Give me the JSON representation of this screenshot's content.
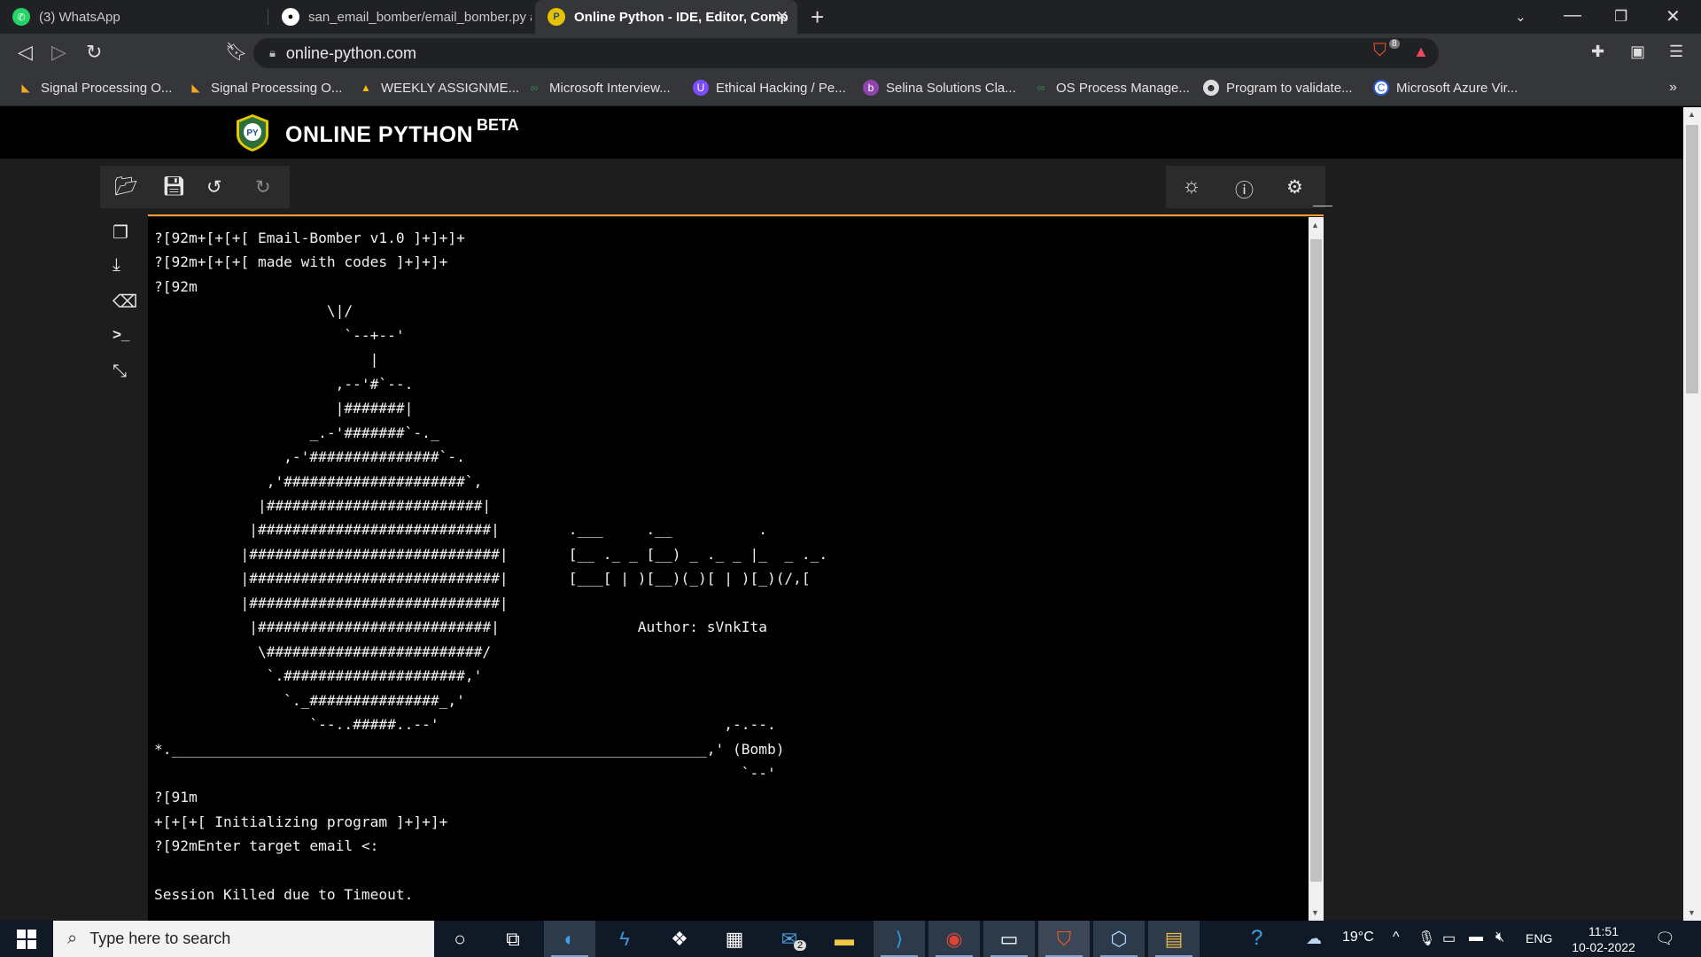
{
  "browser": {
    "tabs": [
      {
        "title": "(3) WhatsApp",
        "icon": "whatsapp-icon",
        "active": false
      },
      {
        "title": "san_email_bomber/email_bomber.py a",
        "icon": "github-icon",
        "active": false
      },
      {
        "title": "Online Python - IDE, Editor, Comp",
        "icon": "online-python-icon",
        "active": true
      }
    ],
    "url": "online-python.com",
    "brave_badge": "8",
    "bookmarks": [
      "Signal Processing O...",
      "Signal Processing O...",
      "WEEKLY ASSIGNME...",
      "Microsoft Interview...",
      "Ethical Hacking / Pe...",
      "Selina Solutions Cla...",
      "OS Process Manage...",
      "Program to validate...",
      "Microsoft Azure Vir..."
    ]
  },
  "site": {
    "logo_text": "PY",
    "title": "ONLINE PYTHON",
    "badge": "BETA"
  },
  "terminal": {
    "lines": [
      "?[92m+[+[+[ Email-Bomber v1.0 ]+]+]+",
      "?[92m+[+[+[ made with codes ]+]+]+",
      "?[92m",
      "                    \\|/",
      "                      `--+--'",
      "                         |",
      "                     ,--'#`--.",
      "                     |#######|",
      "                  _.-'#######`-._",
      "               ,-'###############`-.",
      "             ,'#####################`,",
      "            |#########################|",
      "           |###########################|        .___     .__          .",
      "          |#############################|       [__ ._ _ [__) _ ._ _ |_  _ ._.",
      "          |#############################|       [___[ | )[__)(_)[ | )[_)(/,[",
      "          |#############################|",
      "           |###########################|                Author: sVnkIta",
      "            \\#########################/",
      "             `.#####################,'",
      "               `._###############_,'",
      "                  `--..#####..--'                                 ,-.--.",
      "*.______________________________________________________________,' (Bomb)",
      "                                                                    `--'",
      "?[91m",
      "+[+[+[ Initializing program ]+]+]+",
      "?[92mEnter target email <:",
      "",
      "Session Killed due to Timeout."
    ]
  },
  "taskbar": {
    "search_placeholder": "Type here to search",
    "mail_badge": "2",
    "temperature": "19°C",
    "language": "ENG",
    "time": "11:51",
    "date": "10-02-2022"
  },
  "colors": {
    "accent_orange": "#ff9d33",
    "terminal_bg": "#000000",
    "terminal_fg": "#f0f0f0",
    "chrome_dark": "#202124",
    "chrome_mid": "#35363a"
  }
}
